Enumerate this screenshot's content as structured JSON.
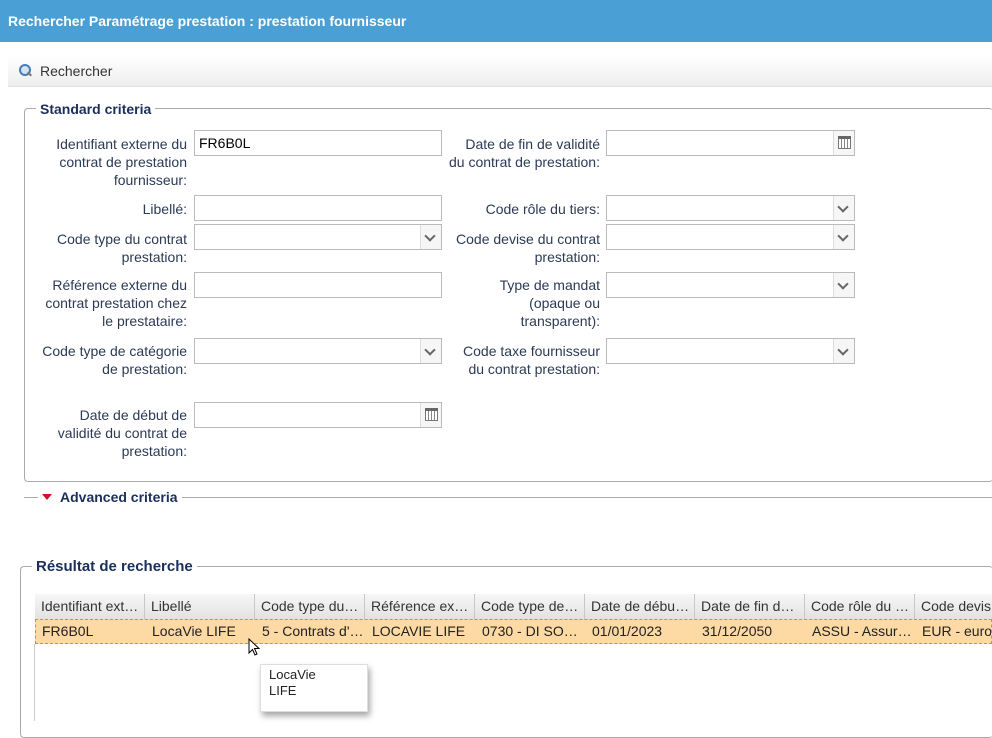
{
  "window": {
    "title": "Rechercher Paramétrage prestation : prestation fournisseur"
  },
  "toolbar": {
    "search_label": "Rechercher"
  },
  "standard": {
    "legend": "Standard criteria",
    "fields": {
      "ident_externe": {
        "label": "Identifiant externe du contrat de prestation fournisseur:",
        "value": "FR6B0L"
      },
      "libelle": {
        "label": "Libellé:",
        "value": ""
      },
      "code_type_contrat": {
        "label": "Code type du contrat prestation:",
        "value": ""
      },
      "ref_externe": {
        "label": "Référence externe du contrat prestation chez le prestataire:",
        "value": ""
      },
      "code_type_categorie": {
        "label": "Code type de catégorie de prestation:",
        "value": ""
      },
      "date_debut": {
        "label": "Date de début de validité du contrat de prestation:",
        "value": ""
      },
      "date_fin": {
        "label": "Date de fin de validité du contrat de prestation:",
        "value": ""
      },
      "code_role_tiers": {
        "label": "Code rôle du tiers:",
        "value": ""
      },
      "code_devise": {
        "label": "Code devise du contrat prestation:",
        "value": ""
      },
      "type_mandat": {
        "label": "Type de mandat (opaque ou transparent):",
        "value": ""
      },
      "code_taxe": {
        "label": "Code taxe fournisseur du contrat prestation:",
        "value": ""
      }
    }
  },
  "advanced": {
    "legend": "Advanced criteria"
  },
  "results": {
    "legend": "Résultat de recherche",
    "columns": [
      "Identifiant ext…",
      "Libellé",
      "Code type du…",
      "Référence ex…",
      "Code type de…",
      "Date de débu…",
      "Date de fin d…",
      "Code rôle du …",
      "Code devis"
    ],
    "rows": [
      [
        "FR6B0L",
        "LocaVie LIFE",
        "5 - Contrats d'…",
        "LOCAVIE LIFE",
        "0730 - DI SO…",
        "01/01/2023",
        "31/12/2050",
        "ASSU - Assur…",
        "EUR - euro"
      ]
    ]
  },
  "tooltip": {
    "line1": "LocaVie",
    "line2": "LIFE"
  }
}
